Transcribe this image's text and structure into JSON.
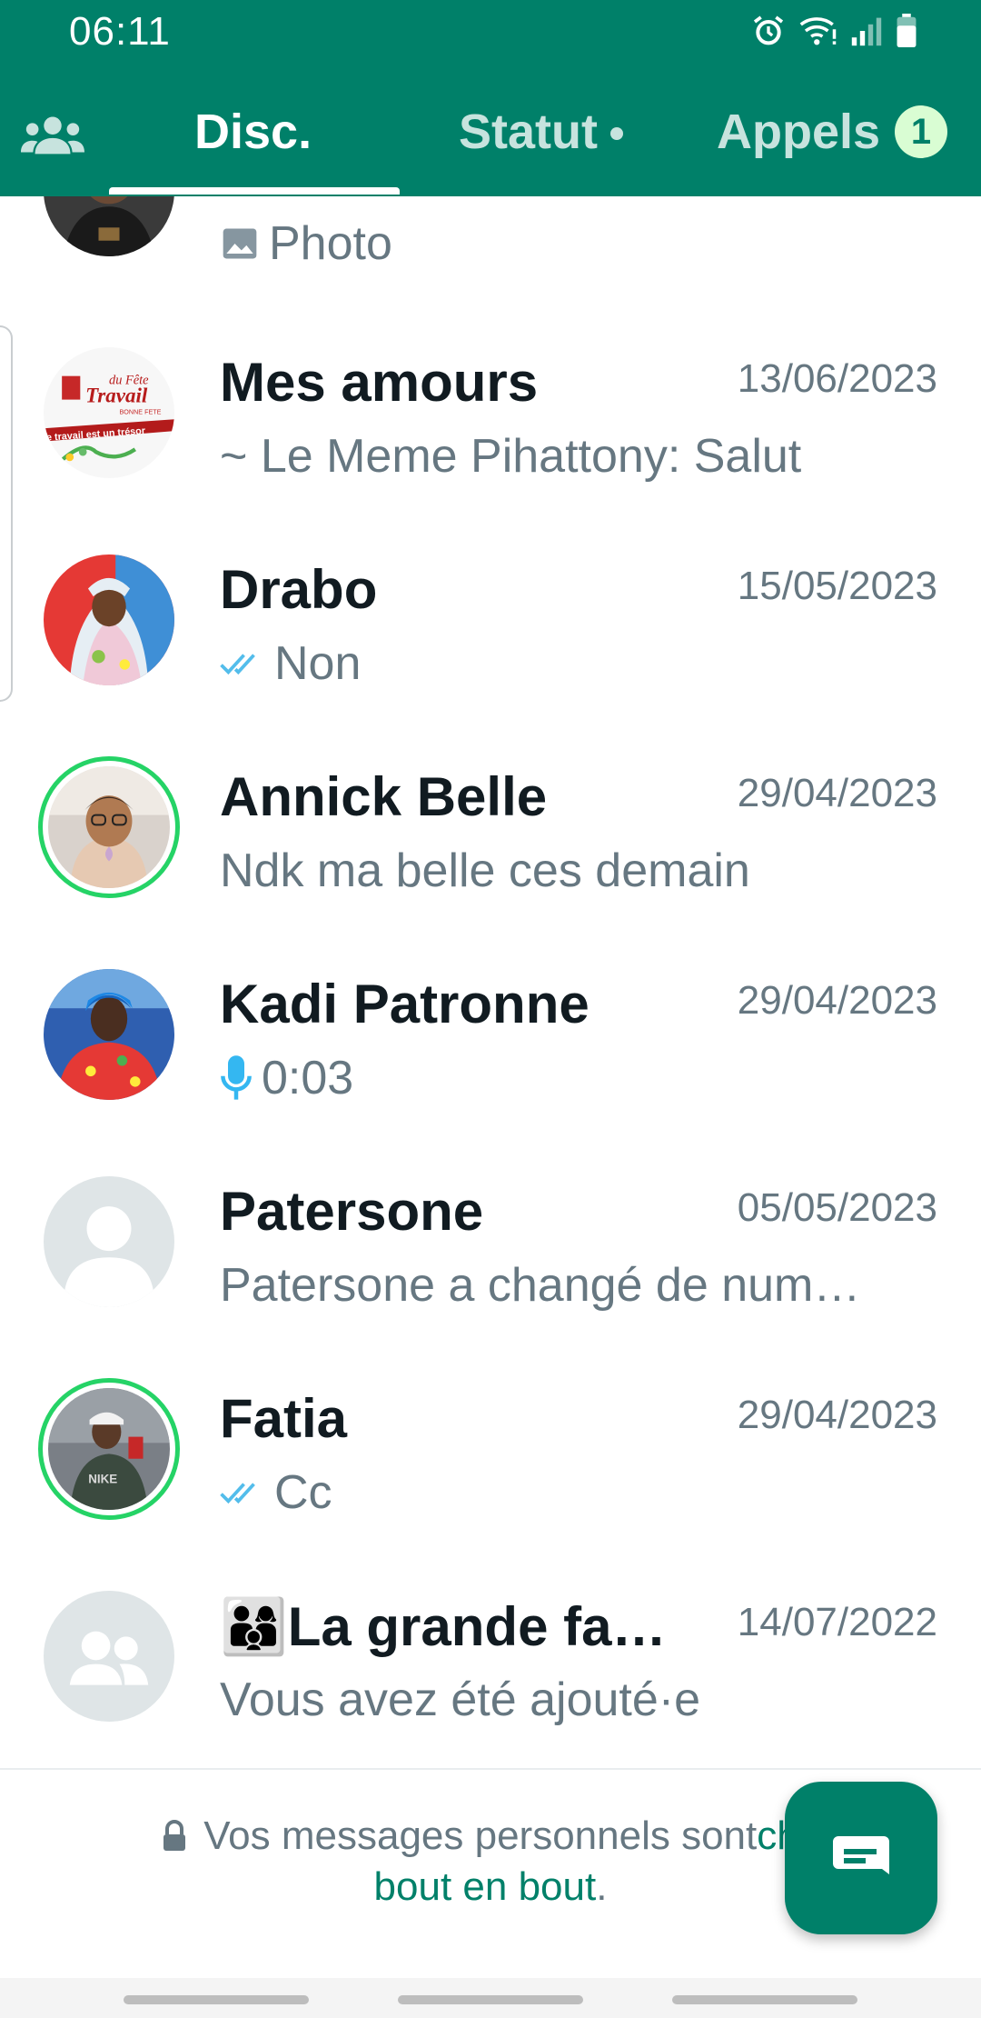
{
  "status_bar": {
    "time": "06:11"
  },
  "tabs": {
    "community_icon": "people-icon",
    "disc": "Disc.",
    "statut": "Statut",
    "appels": "Appels",
    "appels_badge": "1"
  },
  "chats": [
    {
      "name": "",
      "date": "",
      "preview": "Photo",
      "preview_icon": "photo-icon"
    },
    {
      "name": "Mes amours",
      "date": "13/06/2023",
      "preview": "~ Le Meme Pihattony: Salut",
      "preview_icon": ""
    },
    {
      "name": "Drabo",
      "date": "15/05/2023",
      "preview": "Non",
      "preview_icon": "double-check-icon"
    },
    {
      "name": "Annick Belle",
      "date": "29/04/2023",
      "preview": "Ndk ma belle ces demain",
      "preview_icon": ""
    },
    {
      "name": "Kadi Patronne",
      "date": "29/04/2023",
      "preview": "0:03",
      "preview_icon": "microphone-icon"
    },
    {
      "name": "Patersone",
      "date": "05/05/2023",
      "preview": "Patersone a changé de num…",
      "preview_icon": ""
    },
    {
      "name": "Fatia",
      "date": "29/04/2023",
      "preview": "Cc",
      "preview_icon": "double-check-icon"
    },
    {
      "name": "👨‍👩‍👦La grande fa…",
      "date": "14/07/2022",
      "preview": "Vous avez été ajouté·e",
      "preview_icon": ""
    }
  ],
  "avatar_texts": {
    "mes_amours_line1": "du Fête",
    "mes_amours_line2": "Travail",
    "mes_amours_line3": "BONNE FETE",
    "mes_amours_line4": "e travail est un trésor",
    "fatia_shirt": "NIKE"
  },
  "footer": {
    "encryption_text": "Vos messages personnels sont ",
    "encryption_link1": "chif",
    "encryption_link2": "bout en bout",
    "encryption_end": "."
  },
  "fab_icon": "new-chat-icon",
  "colors": {
    "primary": "#008069",
    "accent_ring": "#25d366",
    "check_blue": "#53bdeb",
    "text_secondary": "#667781"
  }
}
